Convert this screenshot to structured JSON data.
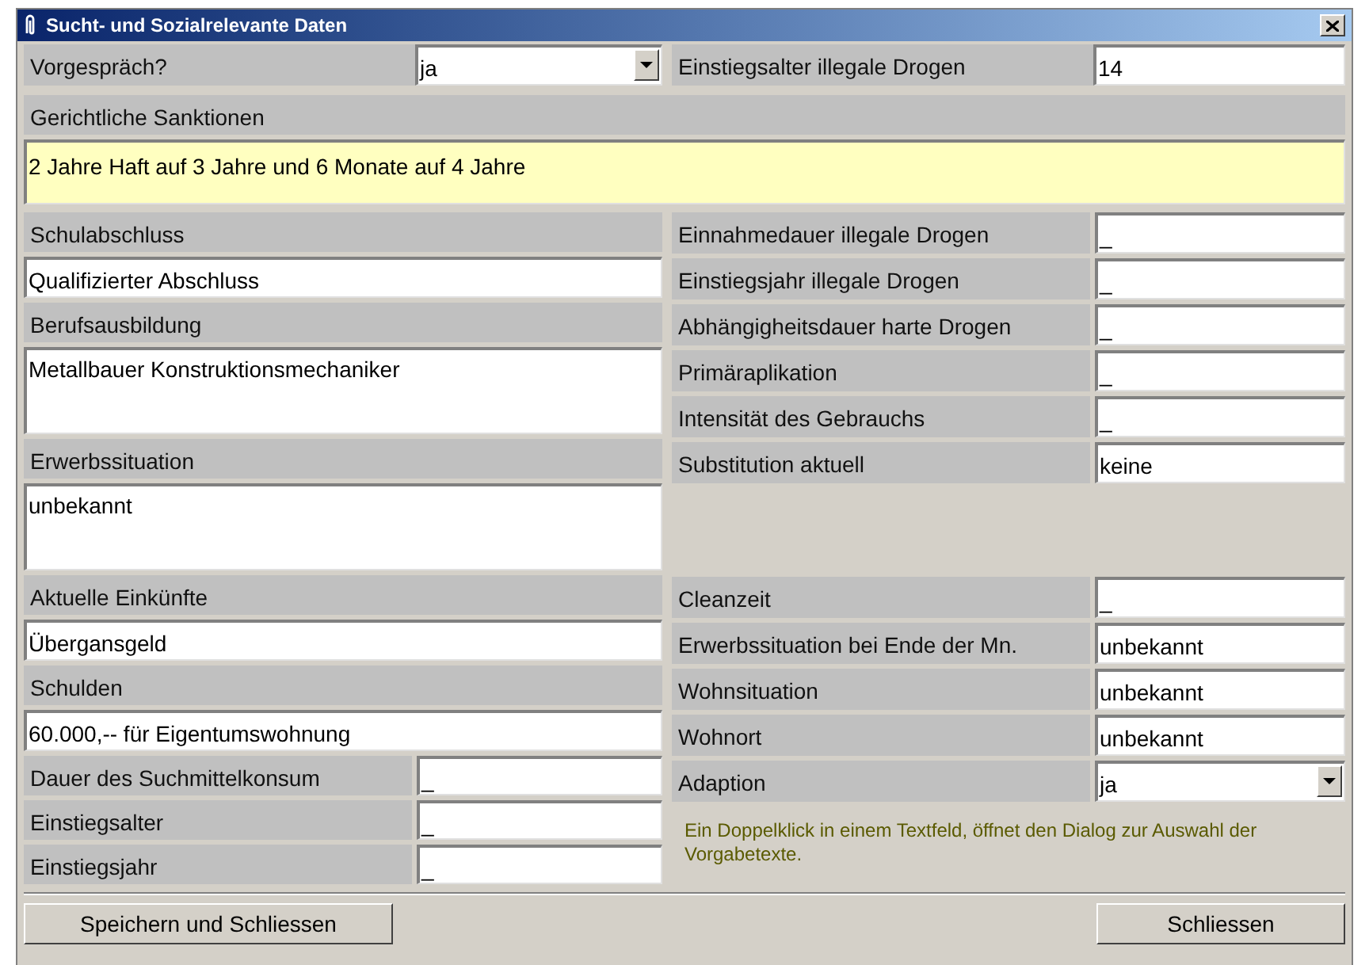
{
  "window": {
    "title": "Sucht- und Sozialrelevante Daten"
  },
  "top": [
    {
      "kind": "dropdown",
      "label": "Vorgespräch?",
      "value": "ja"
    },
    {
      "kind": "field",
      "label": "Einstiegsalter illegale Drogen",
      "value": "14"
    }
  ],
  "sanctions": {
    "label": "Gerichtliche Sanktionen",
    "value": "2 Jahre Haft auf 3 Jahre und 6 Monate auf 4 Jahre"
  },
  "left_column": [
    {
      "kind": "header",
      "label": "Schulabschluss"
    },
    {
      "kind": "field",
      "value": "Qualifizierter Abschluss"
    },
    {
      "kind": "header",
      "label": "Berufsausbildung"
    },
    {
      "kind": "memo",
      "value": "Metallbauer Konstruktionsmechaniker"
    },
    {
      "kind": "header",
      "label": "Erwerbssituation"
    },
    {
      "kind": "memo",
      "value": "unbekannt"
    },
    {
      "kind": "header",
      "label": "Aktuelle Einkünfte"
    },
    {
      "kind": "field",
      "value": "Übergansgeld"
    },
    {
      "kind": "header",
      "label": "Schulden"
    },
    {
      "kind": "field",
      "value": "60.000,-- für Eigentumswohnung"
    },
    {
      "kind": "pair",
      "label": "Dauer des Suchmittelkonsum",
      "value": "_"
    },
    {
      "kind": "pair",
      "label": "Einstiegsalter",
      "value": "_"
    },
    {
      "kind": "pair",
      "label": "Einstiegsjahr",
      "value": "_"
    }
  ],
  "right_upper": [
    {
      "kind": "field",
      "label": "Einnahmedauer illegale Drogen",
      "value": "_"
    },
    {
      "kind": "field",
      "label": "Einstiegsjahr illegale Drogen",
      "value": "_"
    },
    {
      "kind": "field",
      "label": "Abhängigheitsdauer harte Drogen",
      "value": "_"
    },
    {
      "kind": "field",
      "label": "Primäraplikation",
      "value": "_"
    },
    {
      "kind": "field",
      "label": "Intensität des Gebrauchs",
      "value": "_"
    },
    {
      "kind": "field",
      "label": "Substitution aktuell",
      "value": "keine"
    }
  ],
  "right_lower": [
    {
      "kind": "field",
      "label": "Cleanzeit",
      "value": "_"
    },
    {
      "kind": "field",
      "label": "Erwerbssituation bei Ende der Mn.",
      "value": "unbekannt"
    },
    {
      "kind": "field",
      "label": "Wohnsituation",
      "value": "unbekannt"
    },
    {
      "kind": "field",
      "label": "Wohnort",
      "value": "unbekannt"
    },
    {
      "kind": "dropdown",
      "label": "Adaption",
      "value": "ja"
    }
  ],
  "note": "Ein Doppelklick in einem Textfeld, öffnet den Dialog zur Auswahl der Vorgabetexte.",
  "buttons": [
    "Speichern und Schliessen",
    "Schliessen"
  ]
}
